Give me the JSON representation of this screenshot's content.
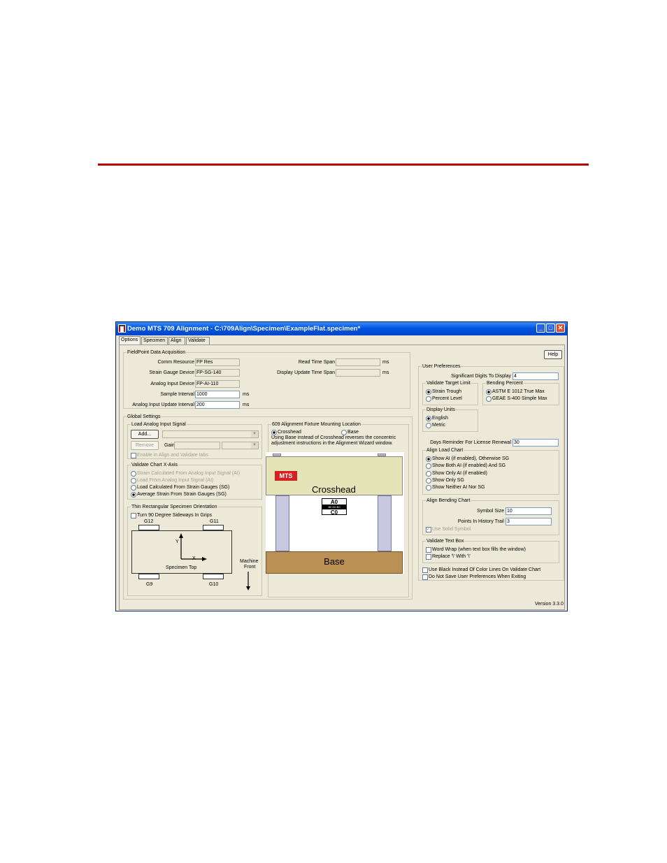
{
  "window": {
    "title": "Demo MTS 709 Alignment - C:\\709Align\\Specimen\\ExampleFlat.specimen*",
    "buttons": {
      "minimize": "_",
      "maximize": "□",
      "close": "✕"
    }
  },
  "tabs": [
    "Options",
    "Specimen",
    "Align",
    "Validate"
  ],
  "help_label": "Help",
  "version": "Version 3.3.0",
  "fieldpoint": {
    "title": "FieldPoint Data Acquisition",
    "comm_resource_label": "Comm Resource",
    "comm_resource": "FP Res",
    "strain_device_label": "Strain Gauge Device",
    "strain_device": "FP-SG-140",
    "analog_device_label": "Analog Input Device",
    "analog_device": "FP-AI-110",
    "sample_interval_label": "Sample Interval",
    "sample_interval": "1000",
    "analog_update_label": "Analog Input Update Interval",
    "analog_update": "200",
    "read_span_label": "Read Time Span",
    "display_span_label": "Display Update Time Span",
    "ms": "ms"
  },
  "global": {
    "title": "Global Settings",
    "load_analog": {
      "title": "Load Analog Input Signal",
      "add": "Add...",
      "remove": "Remove",
      "gain": "Gain",
      "enable": "Enable in Align and Validate tabs"
    },
    "xaxis": {
      "title": "Validate Chart X-Axis",
      "options": [
        "Strain Calculated From Analog Input Signal (AI)",
        "Load From Analog Input Signal (AI)",
        "Load Calculated From Strain Gauges (SG)",
        "Average Strain From Strain Gauges (SG)"
      ]
    },
    "thin": {
      "title": "Thin Rectangular Specimen Orientation",
      "turn": "Turn 90 Degree Sideways In Grips",
      "g12": "G12",
      "g11": "G11",
      "g9": "G9",
      "g10": "G10",
      "y": "Y",
      "x": "X",
      "specimen_top": "Specimen Top",
      "machine": "Machine",
      "front": "Front"
    }
  },
  "fixture": {
    "title": "609 Alignment Fixture Mounting Location",
    "crosshead_opt": "Crosshead",
    "base_opt": "Base",
    "note": "Using Base instead of Crosshead reverses the concentric adjustment instructions in the Alignment Wizard window.",
    "logo": "MTS",
    "crosshead": "Crosshead",
    "base": "Base",
    "a0": "A0",
    "c0": "C0",
    "mid": "B0 D0 B0"
  },
  "user_prefs": {
    "title": "User Preferences",
    "sig_digits_label": "Significant Digits To Display",
    "sig_digits": "4",
    "target_limit": {
      "title": "Validate Target Limit",
      "options": [
        "Strain Trough",
        "Percent Level"
      ]
    },
    "bending": {
      "title": "Bending Percent",
      "options": [
        "ASTM E 1012 True Max",
        "GEAE S-400 Simple Max"
      ]
    },
    "units": {
      "title": "Display Units",
      "options": [
        "English",
        "Metric"
      ]
    },
    "days_label": "Days Reminder For License Renewal",
    "days": "30",
    "load_chart": {
      "title": "Align Load Chart",
      "options": [
        "Show AI (if enabled), Otherwise SG",
        "Show Both AI (if enabled) And SG",
        "Show Only AI (if enabled)",
        "Show Only SG",
        "Show Neither AI Nor SG"
      ]
    },
    "bend_chart": {
      "title": "Align Bending Chart",
      "symbol_label": "Symbol Size",
      "symbol": "10",
      "points_label": "Points In History Trail",
      "points": "3",
      "solid": "Use Solid Symbol"
    },
    "text_box": {
      "title": "Validate Text Box",
      "word_wrap": "Word Wrap (when text box fills the window)",
      "replace": "Replace '\\' With '\\'"
    },
    "use_black": "Use Black Instead Of Color Lines On Validate Chart",
    "do_not_save": "Do Not Save User Preferences When Exiting"
  }
}
